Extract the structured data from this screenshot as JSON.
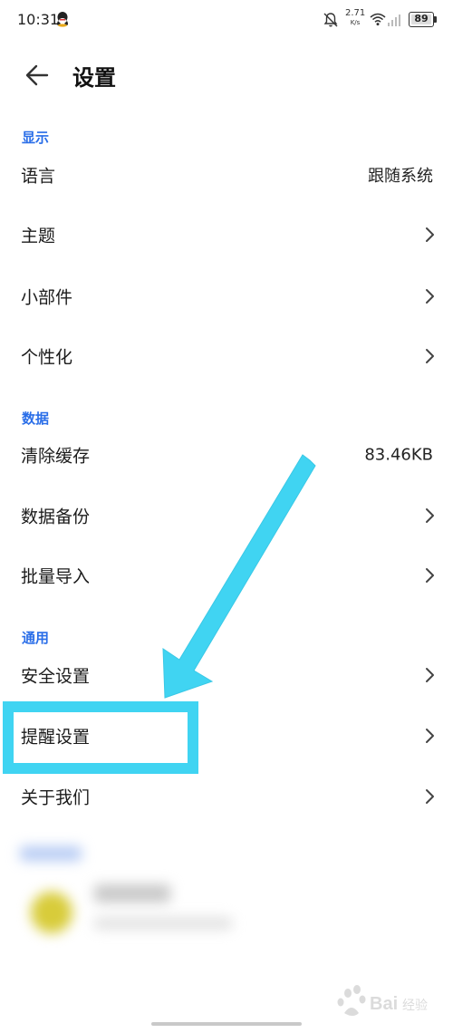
{
  "status_bar": {
    "time": "10:31",
    "net_speed_value": "2.71",
    "net_speed_unit": "K/s",
    "battery": "89"
  },
  "header": {
    "title": "设置"
  },
  "sections": [
    {
      "title": "显示",
      "rows": [
        {
          "label": "语言",
          "value": "跟随系统"
        },
        {
          "label": "主题"
        },
        {
          "label": "小部件"
        },
        {
          "label": "个性化"
        }
      ]
    },
    {
      "title": "数据",
      "rows": [
        {
          "label": "清除缓存",
          "value": "83.46KB"
        },
        {
          "label": "数据备份"
        },
        {
          "label": "批量导入"
        }
      ]
    },
    {
      "title": "通用",
      "rows": [
        {
          "label": "安全设置"
        },
        {
          "label": "提醒设置"
        },
        {
          "label": "关于我们"
        }
      ]
    }
  ],
  "annotation_color": "#40d4f2",
  "accent_color": "#2a6ee8",
  "icons": [
    "qq-icon",
    "bell-off-icon",
    "wifi-icon",
    "signal-icon",
    "back-arrow-icon",
    "chevron-right-icon"
  ]
}
